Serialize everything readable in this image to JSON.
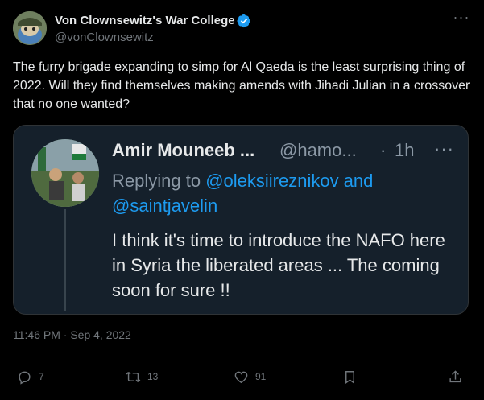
{
  "author": {
    "display_name": "Von Clownsewitz's War College",
    "handle": "@vonClownsewitz",
    "verified": true
  },
  "tweet": {
    "text": "The furry brigade expanding to simp for Al Qaeda is the least surprising thing of 2022. Will they find themselves making amends with Jihadi Julian in a crossover that no one wanted?",
    "timestamp": "11:46 PM · Sep 4, 2022"
  },
  "quoted": {
    "display_name": "Amir Mouneeb ...",
    "handle": "@hamo...",
    "separator": "·",
    "time": "1h",
    "replying_prefix": "Replying to ",
    "mention_1": "@oleksiireznikov and",
    "mention_2": "@saintjavelin",
    "text": "I think it's time to introduce the NAFO here in Syria the liberated areas ... The coming soon for sure !!"
  },
  "actions": {
    "replies": "7",
    "retweets": "13",
    "likes": "91"
  },
  "colors": {
    "background": "#000000",
    "accent": "#1d9bf0",
    "muted": "#71767b",
    "quote_background": "#15202b"
  },
  "icons": [
    "more-icon",
    "verified-badge-icon",
    "reply-icon",
    "retweet-icon",
    "like-icon",
    "bookmark-icon",
    "share-icon"
  ]
}
